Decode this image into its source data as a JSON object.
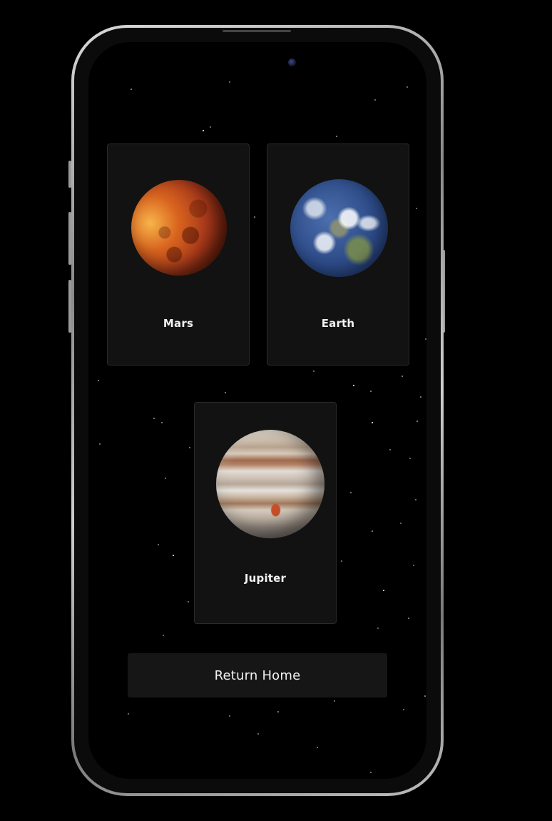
{
  "planets": [
    {
      "name": "Mars",
      "icon": "mars-planet-image"
    },
    {
      "name": "Earth",
      "icon": "earth-planet-image"
    },
    {
      "name": "Jupiter",
      "icon": "jupiter-planet-image"
    }
  ],
  "actions": {
    "return_home_label": "Return Home"
  },
  "colors": {
    "background": "#000000",
    "card_background": "#121212",
    "card_border": "#2a2a2a",
    "button_background": "#161616",
    "text": "#f2f2f2"
  }
}
